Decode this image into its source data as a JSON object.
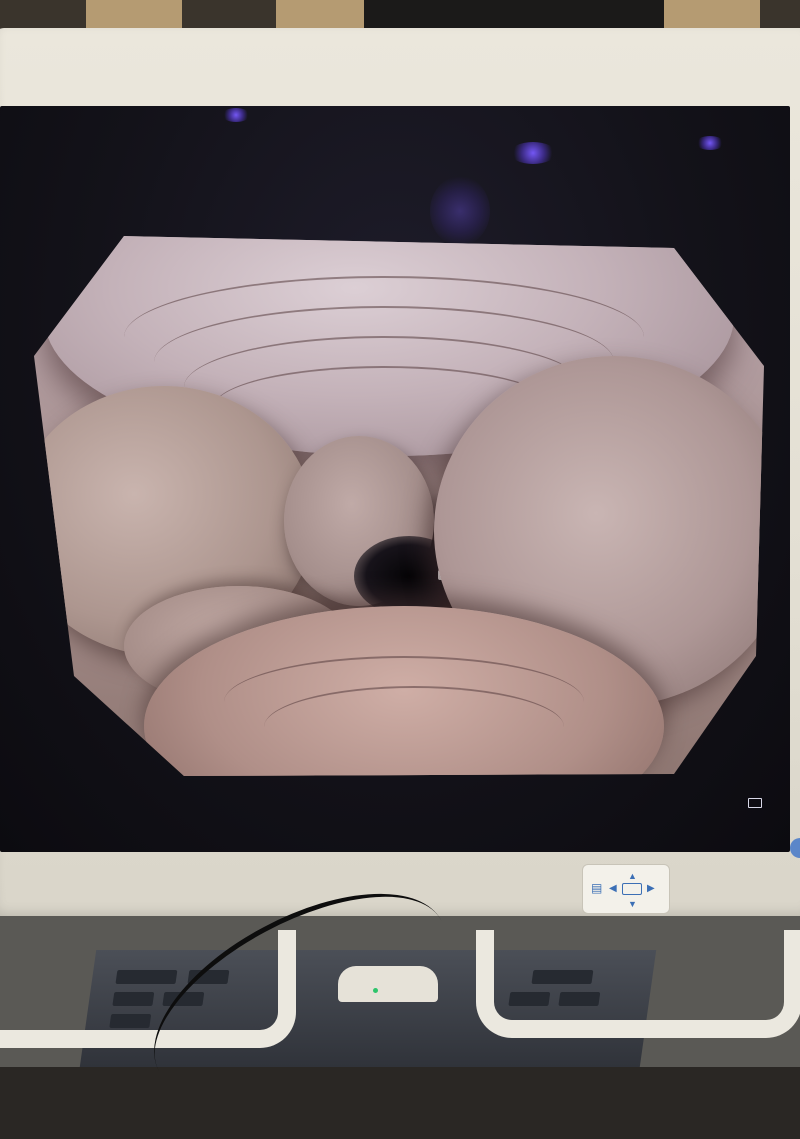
{
  "scene": {
    "colors": {
      "bezel": "#e3dfd3",
      "screen": "#131219",
      "mucosa": "#b39a9c",
      "lumen": "#0d0b0e",
      "panel_accent": "#3b6fb5",
      "glare": "#6a4cff"
    }
  },
  "monitor": {
    "panel_icons": [
      "input-select-icon",
      "arrow-left-icon",
      "arrow-up-icon",
      "menu-rect-icon",
      "arrow-down-icon",
      "arrow-right-icon"
    ]
  }
}
